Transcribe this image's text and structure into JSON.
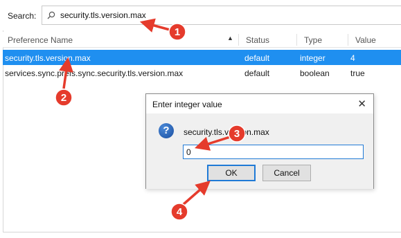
{
  "search": {
    "label": "Search:",
    "value": "security.tls.version.max",
    "icon": "search-icon"
  },
  "table": {
    "columns": [
      "Preference Name",
      "Status",
      "Type",
      "Value"
    ],
    "rows": [
      {
        "name": "security.tls.version.max",
        "status": "default",
        "type": "integer",
        "value": "4"
      },
      {
        "name": "services.sync.prefs.sync.security.tls.version.max",
        "status": "default",
        "type": "boolean",
        "value": "true"
      }
    ]
  },
  "dialog": {
    "title": "Enter integer value",
    "prompt": "security.tls.version.max",
    "input_value": "0",
    "ok_label": "OK",
    "cancel_label": "Cancel",
    "close_glyph": "✕",
    "icon_glyph": "?"
  },
  "annotations": {
    "color": "#e53b2c",
    "labels": [
      "1",
      "2",
      "3",
      "4"
    ]
  },
  "colors": {
    "selection": "#1f8ff0",
    "accent": "#1f7ad6"
  }
}
